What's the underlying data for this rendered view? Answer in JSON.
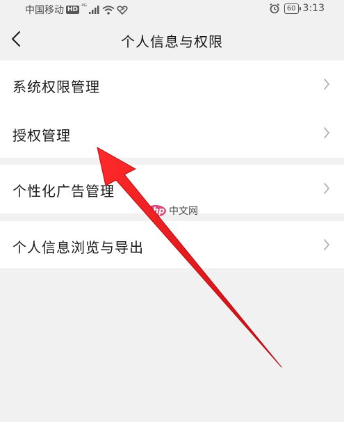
{
  "status_bar": {
    "carrier": "中国移动",
    "hd_badge": "HD",
    "network": "⁴ᴳ",
    "battery": "60",
    "time": "3:13"
  },
  "header": {
    "title": "个人信息与权限"
  },
  "sections": [
    {
      "items": [
        {
          "label": "系统权限管理"
        },
        {
          "label": "授权管理"
        }
      ]
    },
    {
      "items": [
        {
          "label": "个性化广告管理"
        }
      ]
    },
    {
      "items": [
        {
          "label": "个人信息浏览与导出"
        }
      ]
    }
  ],
  "watermark": {
    "logo": "php",
    "text": "中文网"
  },
  "colors": {
    "background": "#f1f1f1",
    "card": "#ffffff",
    "arrow": "#e8141b",
    "chevron": "#b3b3b3"
  }
}
